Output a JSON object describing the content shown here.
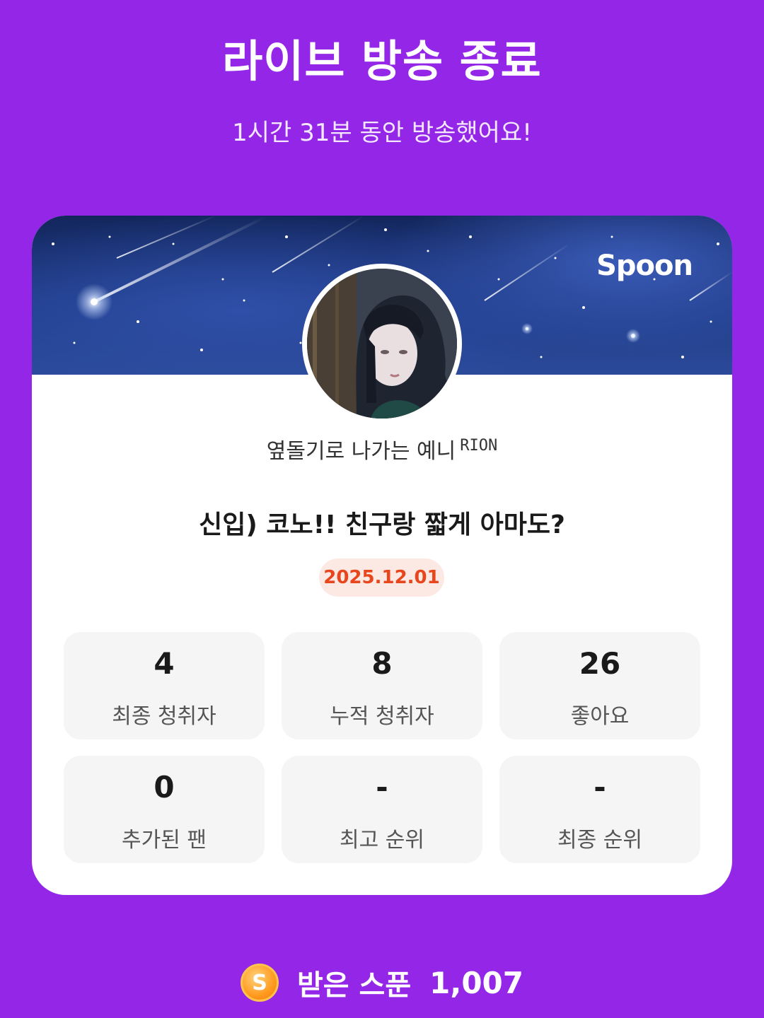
{
  "header": {
    "title": "라이브 방송 종료",
    "subtitle": "1시간 31분 동안 방송했어요!"
  },
  "card": {
    "brand": "Spoon",
    "nickname": "옆돌기로 나가는 예니",
    "nickname_tag": "RION",
    "live_title": "신입) 코노!! 친구랑 짧게 아마도?",
    "date": "2025.12.01",
    "stats": [
      {
        "value": "4",
        "label": "최종 청취자"
      },
      {
        "value": "8",
        "label": "누적 청취자"
      },
      {
        "value": "26",
        "label": "좋아요"
      },
      {
        "value": "0",
        "label": "추가된 팬"
      },
      {
        "value": "-",
        "label": "최고 순위"
      },
      {
        "value": "-",
        "label": "최종 순위"
      }
    ]
  },
  "footer": {
    "coin_letter": "S",
    "spoon_label": "받은 스푼",
    "spoon_value": "1,007"
  },
  "colors": {
    "background": "#9426e8",
    "date_badge_text": "#e8471e",
    "date_badge_bg": "#fde9e4"
  },
  "icons": {
    "coin": "spoon-coin-icon",
    "avatar": "profile-avatar"
  }
}
